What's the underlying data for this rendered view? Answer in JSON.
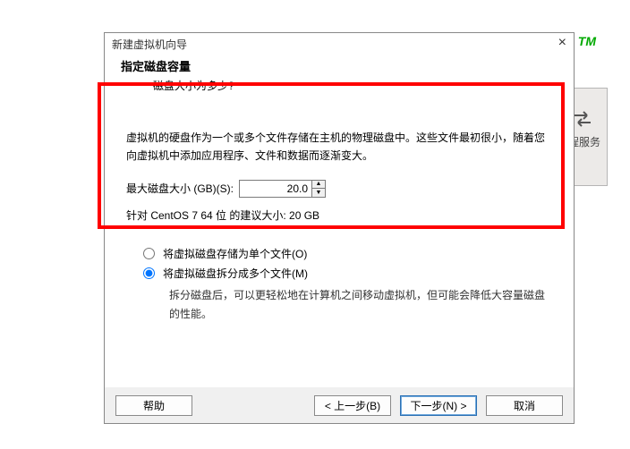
{
  "background": {
    "tm": "TM",
    "remote_server": "远程服务器"
  },
  "dialog": {
    "title": "新建虚拟机向导",
    "header": {
      "title": "指定磁盘容量",
      "subtitle": "磁盘大小为多少?"
    },
    "body": {
      "description": "虚拟机的硬盘作为一个或多个文件存储在主机的物理磁盘中。这些文件最初很小，随着您向虚拟机中添加应用程序、文件和数据而逐渐变大。",
      "size_label": "最大磁盘大小 (GB)(S):",
      "size_value": "20.0",
      "recommended": "针对 CentOS 7 64 位 的建议大小: 20 GB",
      "options": [
        {
          "label": "将虚拟磁盘存储为单个文件(O)"
        },
        {
          "label": "将虚拟磁盘拆分成多个文件(M)",
          "note": "拆分磁盘后，可以更轻松地在计算机之间移动虚拟机，但可能会降低大容量磁盘的性能。"
        }
      ]
    },
    "footer": {
      "help": "帮助",
      "back": "< 上一步(B)",
      "next": "下一步(N) >",
      "cancel": "取消"
    }
  }
}
